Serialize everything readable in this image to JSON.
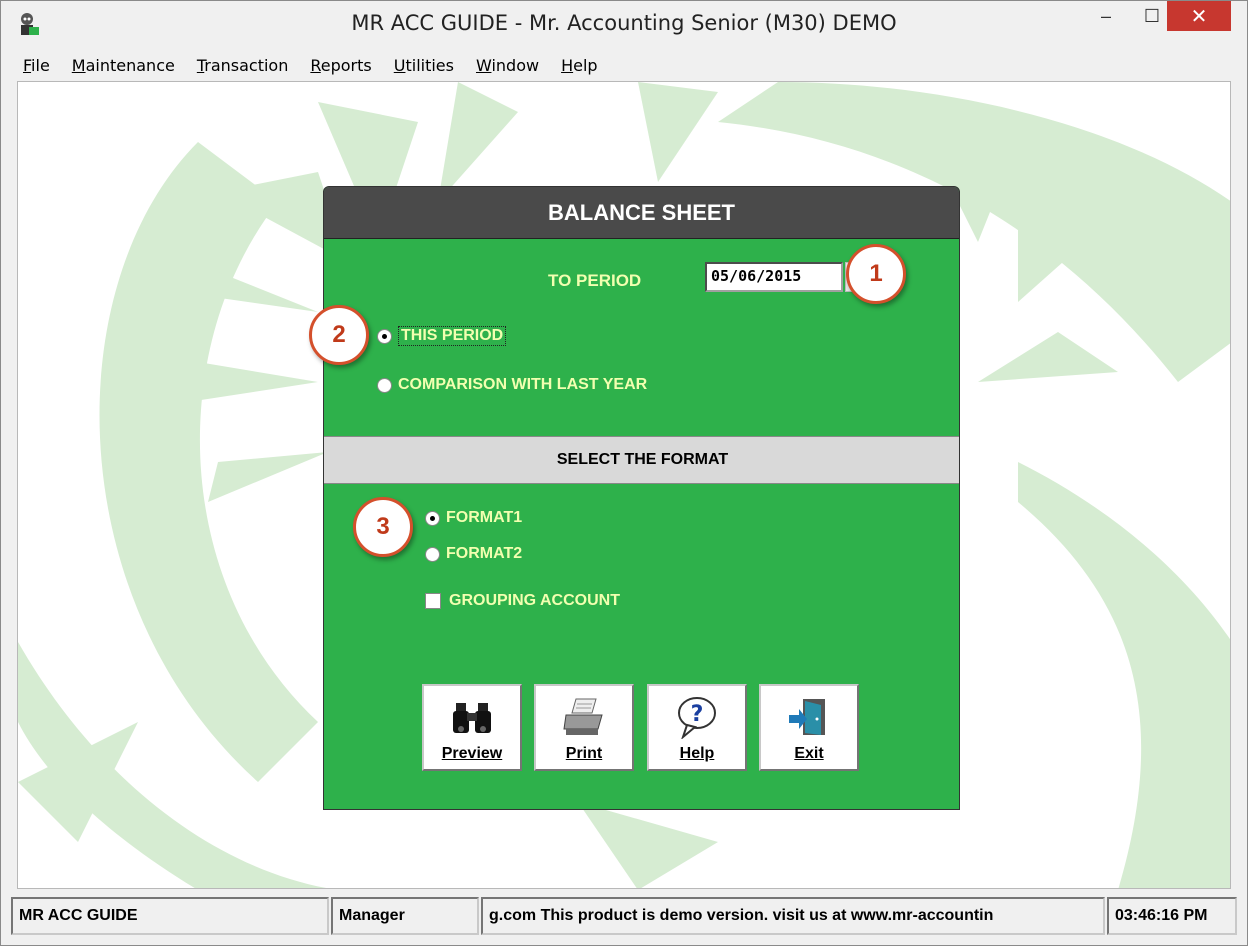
{
  "window": {
    "title": "MR ACC GUIDE - Mr. Accounting Senior (M30) DEMO",
    "minimize": "–",
    "maximize": "☐",
    "close": "✕"
  },
  "menu": {
    "items": [
      {
        "label": "File",
        "mnemonic": "F",
        "rest": "ile"
      },
      {
        "label": "Maintenance",
        "mnemonic": "M",
        "rest": "aintenance"
      },
      {
        "label": "Transaction",
        "mnemonic": "T",
        "rest": "ransaction"
      },
      {
        "label": "Reports",
        "mnemonic": "R",
        "rest": "eports"
      },
      {
        "label": "Utilities",
        "mnemonic": "U",
        "rest": "tilities"
      },
      {
        "label": "Window",
        "mnemonic": "W",
        "rest": "indow"
      },
      {
        "label": "Help",
        "mnemonic": "H",
        "rest": "elp"
      }
    ]
  },
  "dialog": {
    "title": "BALANCE SHEET",
    "to_period_label": "TO PERIOD",
    "to_period_value": "05/06/2015",
    "period_options": [
      {
        "label": "THIS PERIOD",
        "selected": true
      },
      {
        "label": "COMPARISON WITH LAST YEAR",
        "selected": false
      }
    ],
    "format_header": "SELECT THE FORMAT",
    "format_options": [
      {
        "label": "FORMAT1",
        "selected": true
      },
      {
        "label": "FORMAT2",
        "selected": false
      }
    ],
    "grouping_label": "GROUPING ACCOUNT",
    "grouping_checked": false,
    "buttons": {
      "preview": "Preview",
      "print": "Print",
      "help": "Help",
      "exit": "Exit"
    }
  },
  "callouts": [
    "1",
    "2",
    "3"
  ],
  "status": {
    "company": "MR ACC GUIDE",
    "user": "Manager",
    "message": "g.com This product is demo version.  visit us at www.mr-accountin",
    "time": "03:46:16 PM"
  },
  "colors": {
    "dialog_green": "#2eb14b",
    "header_dark": "#4a4a4a",
    "label_yellow": "#f2ffb0",
    "callout_red": "#d4502c",
    "close_red": "#c7372f"
  }
}
